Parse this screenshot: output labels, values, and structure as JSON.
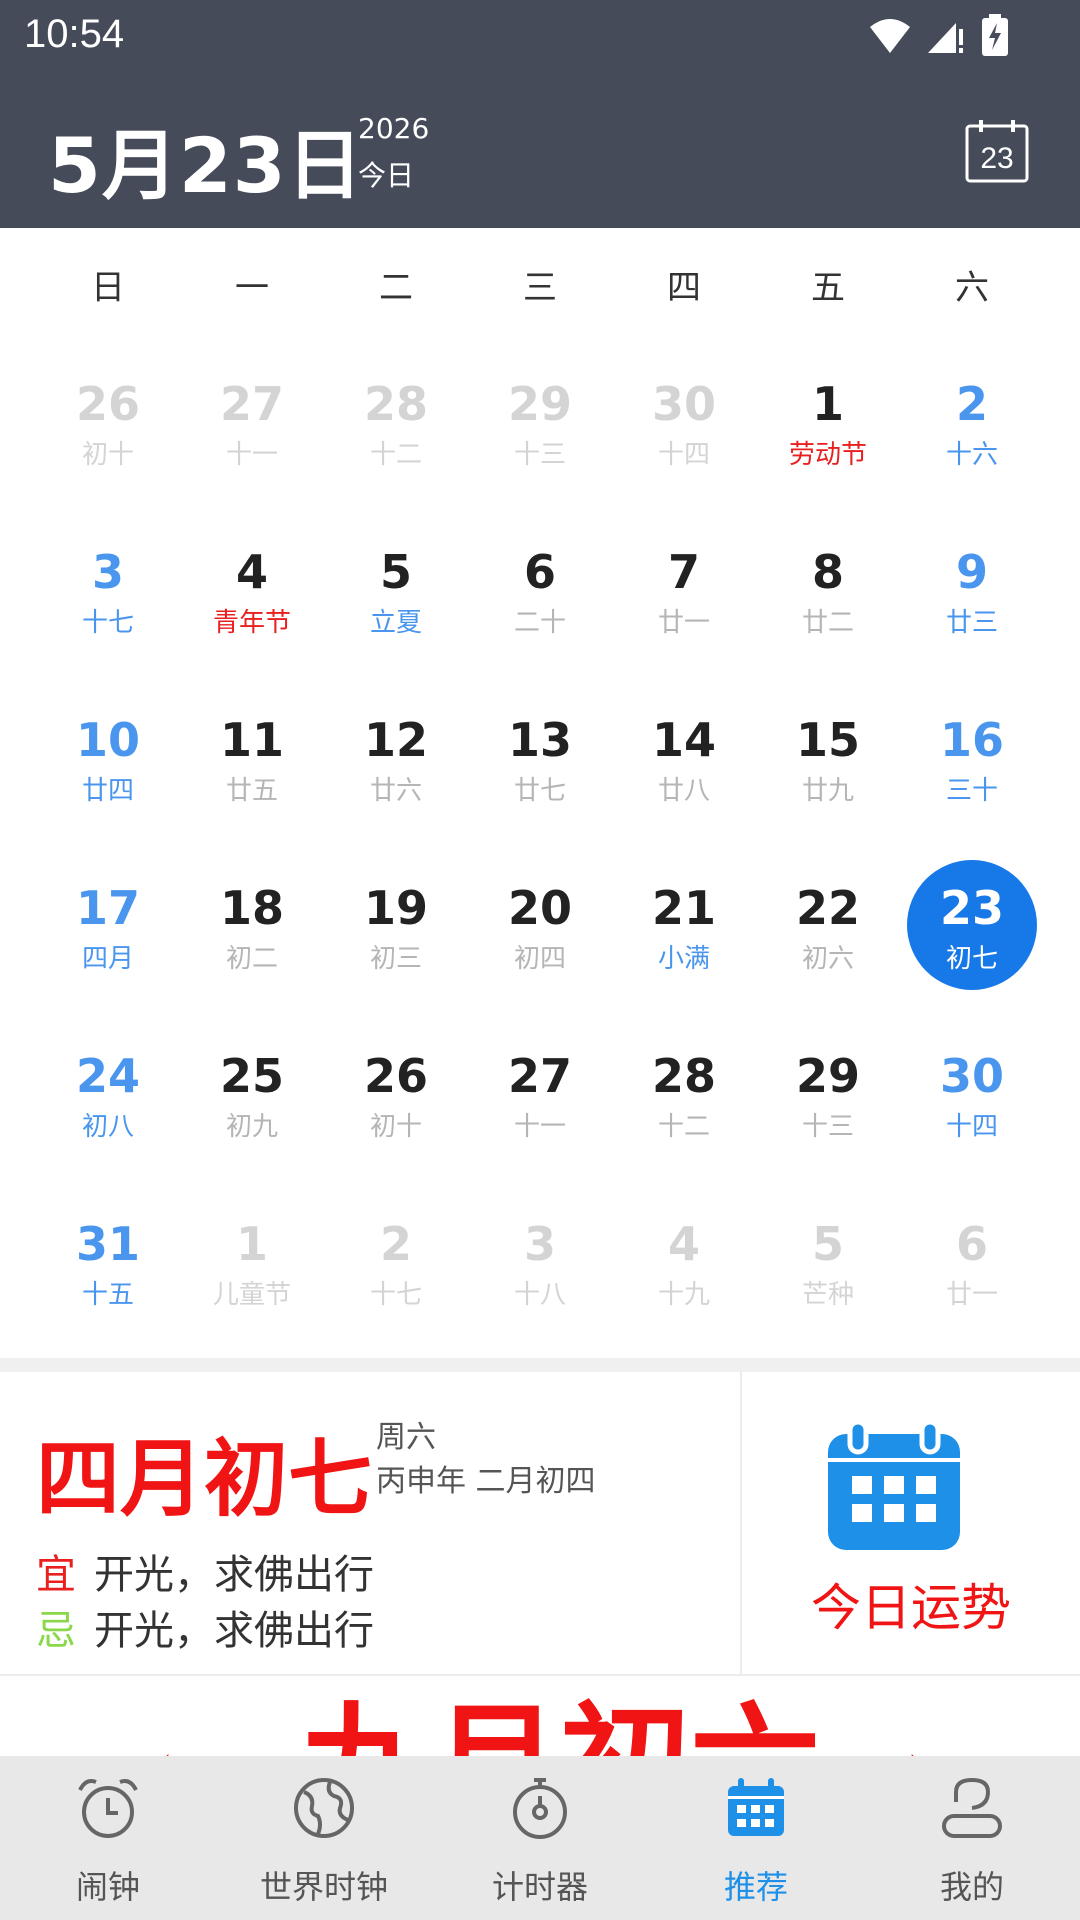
{
  "status_bar": {
    "time": "10:54"
  },
  "header": {
    "date": "5月23日",
    "year": "2026",
    "today_label": "今日",
    "calendar_button_day": "23"
  },
  "weekdays": [
    "日",
    "一",
    "二",
    "三",
    "四",
    "五",
    "六"
  ],
  "calendar_rows": [
    [
      {
        "d": "26",
        "l": "初十",
        "t": "other"
      },
      {
        "d": "27",
        "l": "十一",
        "t": "other"
      },
      {
        "d": "28",
        "l": "十二",
        "t": "other"
      },
      {
        "d": "29",
        "l": "十三",
        "t": "other"
      },
      {
        "d": "30",
        "l": "十四",
        "t": "other"
      },
      {
        "d": "1",
        "l": "劳动节",
        "t": "normal",
        "lc": "red"
      },
      {
        "d": "2",
        "l": "十六",
        "t": "weekend"
      }
    ],
    [
      {
        "d": "3",
        "l": "十七",
        "t": "weekend"
      },
      {
        "d": "4",
        "l": "青年节",
        "t": "normal",
        "lc": "red"
      },
      {
        "d": "5",
        "l": "立夏",
        "t": "normal",
        "lc": "blue"
      },
      {
        "d": "6",
        "l": "二十",
        "t": "normal"
      },
      {
        "d": "7",
        "l": "廿一",
        "t": "normal"
      },
      {
        "d": "8",
        "l": "廿二",
        "t": "normal"
      },
      {
        "d": "9",
        "l": "廿三",
        "t": "weekend"
      }
    ],
    [
      {
        "d": "10",
        "l": "廿四",
        "t": "weekend"
      },
      {
        "d": "11",
        "l": "廿五",
        "t": "normal"
      },
      {
        "d": "12",
        "l": "廿六",
        "t": "normal"
      },
      {
        "d": "13",
        "l": "廿七",
        "t": "normal"
      },
      {
        "d": "14",
        "l": "廿八",
        "t": "normal"
      },
      {
        "d": "15",
        "l": "廿九",
        "t": "normal"
      },
      {
        "d": "16",
        "l": "三十",
        "t": "weekend"
      }
    ],
    [
      {
        "d": "17",
        "l": "四月",
        "t": "weekend"
      },
      {
        "d": "18",
        "l": "初二",
        "t": "normal"
      },
      {
        "d": "19",
        "l": "初三",
        "t": "normal"
      },
      {
        "d": "20",
        "l": "初四",
        "t": "normal"
      },
      {
        "d": "21",
        "l": "小满",
        "t": "normal",
        "lc": "blue"
      },
      {
        "d": "22",
        "l": "初六",
        "t": "normal"
      },
      {
        "d": "23",
        "l": "初七",
        "t": "selected"
      }
    ],
    [
      {
        "d": "24",
        "l": "初八",
        "t": "weekend"
      },
      {
        "d": "25",
        "l": "初九",
        "t": "normal"
      },
      {
        "d": "26",
        "l": "初十",
        "t": "normal"
      },
      {
        "d": "27",
        "l": "十一",
        "t": "normal"
      },
      {
        "d": "28",
        "l": "十二",
        "t": "normal"
      },
      {
        "d": "29",
        "l": "十三",
        "t": "normal"
      },
      {
        "d": "30",
        "l": "十四",
        "t": "weekend"
      }
    ],
    [
      {
        "d": "31",
        "l": "十五",
        "t": "weekend"
      },
      {
        "d": "1",
        "l": "儿童节",
        "t": "other"
      },
      {
        "d": "2",
        "l": "十七",
        "t": "other"
      },
      {
        "d": "3",
        "l": "十八",
        "t": "other"
      },
      {
        "d": "4",
        "l": "十九",
        "t": "other"
      },
      {
        "d": "5",
        "l": "芒种",
        "t": "other"
      },
      {
        "d": "6",
        "l": "廿一",
        "t": "other"
      }
    ]
  ],
  "info": {
    "lunar_date": "四月初七",
    "weekday": "周六",
    "ganzhi": "丙申年 二月初四",
    "yi_label": "宜",
    "yi_text": "开光，求佛出行",
    "ji_label": "忌",
    "ji_text": "开光，求佛出行",
    "fortune_label": "今日运势"
  },
  "lunar_banner": {
    "text": "九月初六",
    "left_arrow": "‹",
    "right_arrow": "›"
  },
  "bottom_nav": [
    {
      "label": "闹钟",
      "icon": "alarm-clock-icon",
      "active": false
    },
    {
      "label": "世界时钟",
      "icon": "globe-icon",
      "active": false
    },
    {
      "label": "计时器",
      "icon": "stopwatch-icon",
      "active": false
    },
    {
      "label": "推荐",
      "icon": "calendar-icon",
      "active": true
    },
    {
      "label": "我的",
      "icon": "person-icon",
      "active": false
    }
  ],
  "colors": {
    "header_bg": "#464b5a",
    "accent_blue": "#1779e8",
    "weekend_blue": "#4a96ee",
    "holiday_red": "#e82020",
    "ji_green": "#8ad84a"
  }
}
